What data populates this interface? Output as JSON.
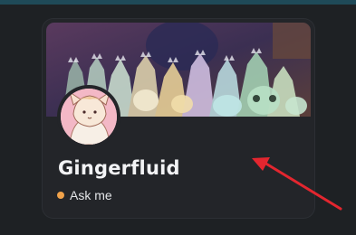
{
  "profile": {
    "username": "Gingerfluid",
    "status_text": "Ask me",
    "status_color": "#f0a24a"
  },
  "icons": {
    "avatar": "fox-character-avatar",
    "banner": "artwork-banner",
    "pointer": "red-arrow"
  },
  "colors": {
    "background": "#1e2124",
    "card": "#232529",
    "accent_strip": "#1f4a58",
    "arrow": "#e3262f"
  }
}
